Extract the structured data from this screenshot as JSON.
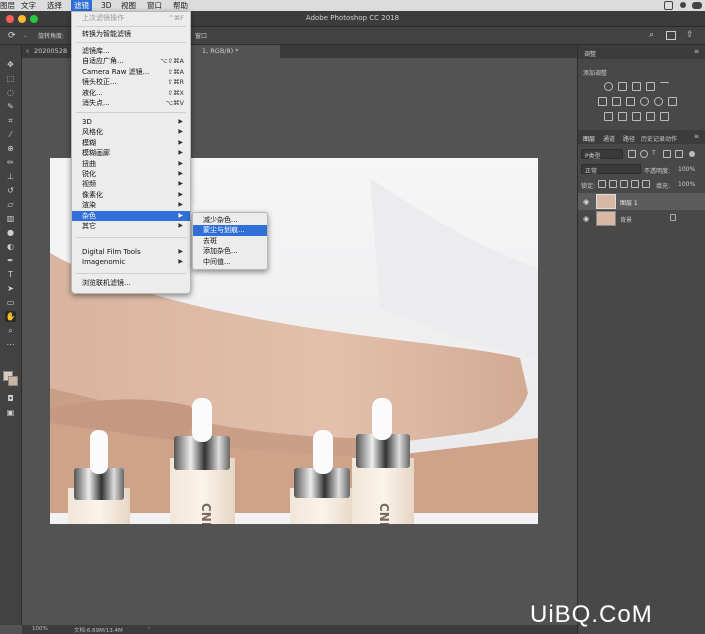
{
  "menubar": {
    "items": [
      {
        "label": "图层",
        "active": false
      },
      {
        "label": "文字",
        "active": false
      },
      {
        "label": "选择",
        "active": false
      },
      {
        "label": "滤镜",
        "active": true
      },
      {
        "label": "3D",
        "active": false
      },
      {
        "label": "视图",
        "active": false
      },
      {
        "label": "窗口",
        "active": false
      },
      {
        "label": "帮助",
        "active": false
      }
    ]
  },
  "window": {
    "title": "Adobe Photoshop CC 2018",
    "traffic_colors": [
      "#fc5f57",
      "#fdbc2e",
      "#28c840"
    ]
  },
  "options_bar": {
    "rotate_label": "旋转角度:",
    "tail_label": "窗口"
  },
  "tabs": [
    {
      "label": "20200528",
      "active": false
    },
    {
      "label": "1, RGB/8) *",
      "active": true
    }
  ],
  "filter_menu": {
    "items": [
      {
        "label": "上次滤镜操作",
        "shortcut": "^⌘F",
        "disabled": true
      },
      {
        "sep": true
      },
      {
        "label": "转换为智能滤镜"
      },
      {
        "sep": true
      },
      {
        "label": "滤镜库..."
      },
      {
        "label": "自适应广角...",
        "shortcut": "⌥⇧⌘A"
      },
      {
        "label": "Camera Raw 滤镜...",
        "shortcut": "⇧⌘A"
      },
      {
        "label": "镜头校正...",
        "shortcut": "⇧⌘R"
      },
      {
        "label": "液化...",
        "shortcut": "⇧⌘X"
      },
      {
        "label": "消失点...",
        "shortcut": "⌥⌘V"
      },
      {
        "sep": true
      },
      {
        "label": "3D",
        "submenu": true
      },
      {
        "label": "风格化",
        "submenu": true
      },
      {
        "label": "模糊",
        "submenu": true
      },
      {
        "label": "模糊画廊",
        "submenu": true
      },
      {
        "label": "扭曲",
        "submenu": true
      },
      {
        "label": "锐化",
        "submenu": true
      },
      {
        "label": "视频",
        "submenu": true
      },
      {
        "label": "像素化",
        "submenu": true
      },
      {
        "label": "渲染",
        "submenu": true
      },
      {
        "label": "杂色",
        "submenu": true,
        "selected": true
      },
      {
        "label": "其它",
        "submenu": true
      },
      {
        "sep": true
      },
      {
        "label": "Digital Film Tools",
        "submenu": true
      },
      {
        "label": "Imagenomic",
        "submenu": true
      },
      {
        "sep": true
      },
      {
        "label": "浏览联机滤镜..."
      }
    ]
  },
  "noise_submenu": {
    "items": [
      {
        "label": "减少杂色..."
      },
      {
        "label": "蒙尘与划痕...",
        "selected": true
      },
      {
        "label": "去斑"
      },
      {
        "label": "添加杂色..."
      },
      {
        "label": "中间值..."
      }
    ]
  },
  "adjust_panel": {
    "tab": "调整",
    "add_label": "添加调整"
  },
  "layers_panel": {
    "tabs": [
      "图层",
      "通道",
      "路径",
      "历史记录",
      "动作"
    ],
    "filter_label": "P类型",
    "blend_mode": "正常",
    "opacity_label": "不透明度:",
    "opacity_value": "100%",
    "lock_label": "锁定:",
    "fill_label": "填充:",
    "fill_value": "100%",
    "layers": [
      {
        "name": "图层 1",
        "selected": true
      },
      {
        "name": "背景",
        "selected": false
      }
    ]
  },
  "status": {
    "zoom": "100%",
    "doc": "文档:6.69M/13.4M"
  },
  "bottle_label": "CNP",
  "watermark": "UiBQ.CoM"
}
